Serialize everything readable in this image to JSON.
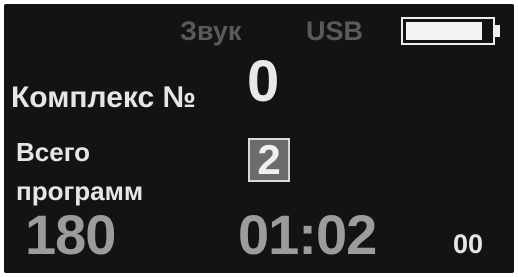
{
  "status_bar": {
    "sound_label": "Звук",
    "usb_label": "USB",
    "battery_level": 0.9
  },
  "complex": {
    "label": "Комплекс №",
    "value": "0"
  },
  "programs": {
    "label_line1": "Всего",
    "label_line2": "программ",
    "count": "2"
  },
  "readout": {
    "left_value": "180",
    "time_main": "01:02",
    "time_sub": "00"
  },
  "colors": {
    "screen_bg": "#131313",
    "dim_text": "#5a5a5a",
    "bright_text": "#e6e6e6",
    "mid_text": "#9c9c9c"
  }
}
